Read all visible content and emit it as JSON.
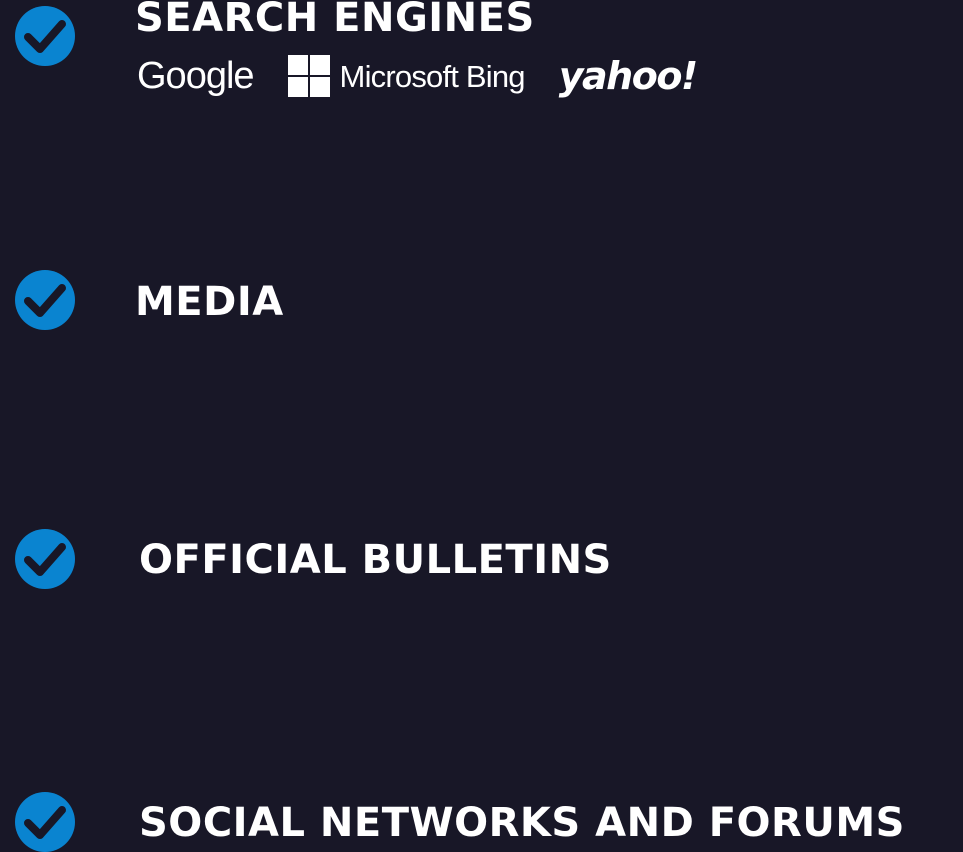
{
  "colors": {
    "background": "#181727",
    "check_fill": "#0a84d0",
    "check_mark": "#181727",
    "text": "#ffffff"
  },
  "items": [
    {
      "icon": "check-circle-icon",
      "heading": "SEARCH ENGINES",
      "logos": {
        "google": "Google",
        "bing": "Microsoft Bing",
        "yahoo": "yahoo!"
      }
    },
    {
      "icon": "check-circle-icon",
      "heading": "MEDIA"
    },
    {
      "icon": "check-circle-icon",
      "heading": "OFFICIAL BULLETINS"
    },
    {
      "icon": "check-circle-icon",
      "heading": "SOCIAL NETWORKS AND FORUMS"
    }
  ]
}
